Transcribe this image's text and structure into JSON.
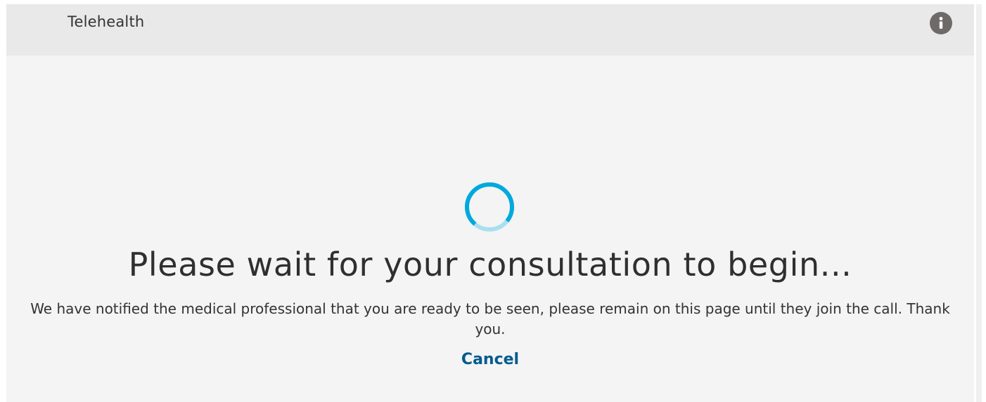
{
  "header": {
    "title": "Telehealth",
    "info_icon": "info-icon"
  },
  "waiting": {
    "spinner_icon": "loading-spinner-icon",
    "headline": "Please wait for your consultation to begin...",
    "message": "We have notified the medical professional that you are ready to be seen, please remain on this page until they join the call. Thank you.",
    "cancel_label": "Cancel"
  },
  "colors": {
    "header_background": "#e9e9e9",
    "page_background": "#f4f4f4",
    "info_icon_background": "#6e6a67",
    "spinner_accent": "#00a9dc",
    "spinner_track": "#a9dff0",
    "link": "#005b8f",
    "text": "#333333"
  }
}
